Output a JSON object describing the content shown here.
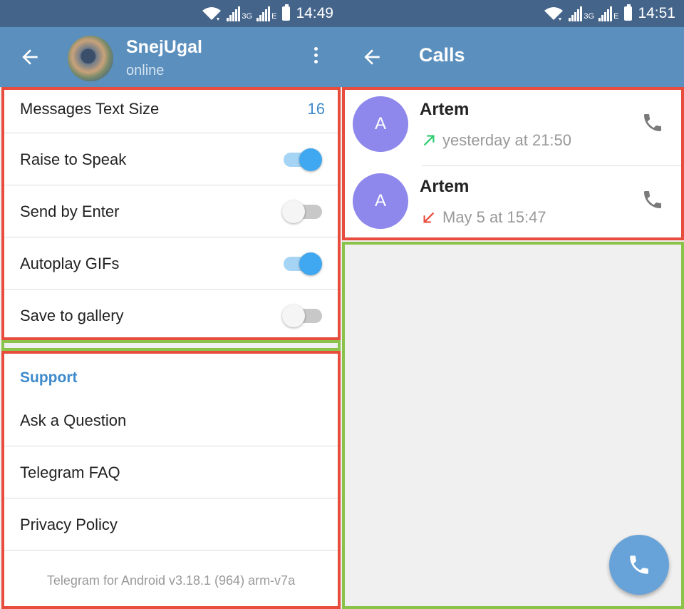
{
  "left": {
    "status": {
      "time": "14:49",
      "net1": "3G",
      "net2": "E"
    },
    "header": {
      "name": "SnejUgal",
      "status": "online"
    },
    "settings": [
      {
        "label": "Messages Text Size",
        "value": "16"
      },
      {
        "label": "Raise to Speak",
        "toggle": true
      },
      {
        "label": "Send by Enter",
        "toggle": false
      },
      {
        "label": "Autoplay GIFs",
        "toggle": true
      },
      {
        "label": "Save to gallery",
        "toggle": false
      }
    ],
    "support": {
      "header": "Support",
      "items": [
        "Ask a Question",
        "Telegram FAQ",
        "Privacy Policy"
      ],
      "version": "Telegram for Android v3.18.1 (964) arm-v7a"
    }
  },
  "right": {
    "status": {
      "time": "14:51",
      "net1": "3G",
      "net2": "E"
    },
    "header": {
      "title": "Calls"
    },
    "calls": [
      {
        "initial": "A",
        "name": "Artem",
        "time": "yesterday at 21:50",
        "direction": "outgoing"
      },
      {
        "initial": "A",
        "name": "Artem",
        "time": "May 5 at 15:47",
        "direction": "missed"
      }
    ]
  },
  "colors": {
    "statusbar": "#45648a",
    "appbar": "#5b8fbd",
    "accent": "#3e8acc",
    "highlight_red": "#e84c3d",
    "highlight_green": "#8bc34a",
    "avatar": "#8e87ec",
    "outgoing_arrow": "#2ecc71",
    "missed_arrow": "#e84c3d"
  }
}
